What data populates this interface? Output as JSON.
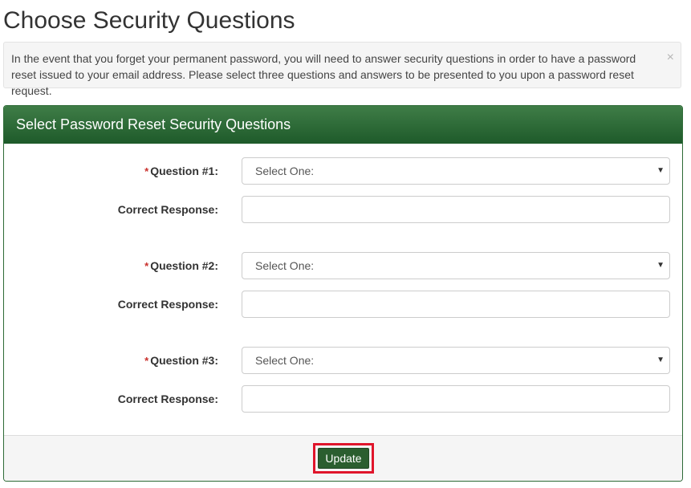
{
  "page": {
    "title": "Choose Security Questions"
  },
  "alert": {
    "text": "In the event that you forget your permanent password, you will need to answer security questions in order to have a password reset issued to your email address. Please select three questions and answers to be presented to you upon a password reset request.",
    "close_icon": "close-icon",
    "close_glyph": "×"
  },
  "panel": {
    "heading": "Select Password Reset Security Questions",
    "header_color": "#2d6a36"
  },
  "questions": [
    {
      "required_mark": "*",
      "label": "Question #1:",
      "selected": "Select One:",
      "response_label": "Correct Response:",
      "response_value": ""
    },
    {
      "required_mark": "*",
      "label": "Question #2:",
      "selected": "Select One:",
      "response_label": "Correct Response:",
      "response_value": ""
    },
    {
      "required_mark": "*",
      "label": "Question #3:",
      "selected": "Select One:",
      "response_label": "Correct Response:",
      "response_value": ""
    }
  ],
  "select_caret": "▼",
  "footer": {
    "update_label": "Update",
    "update_color": "#2b5e2f",
    "highlight_color": "#e0152b"
  }
}
